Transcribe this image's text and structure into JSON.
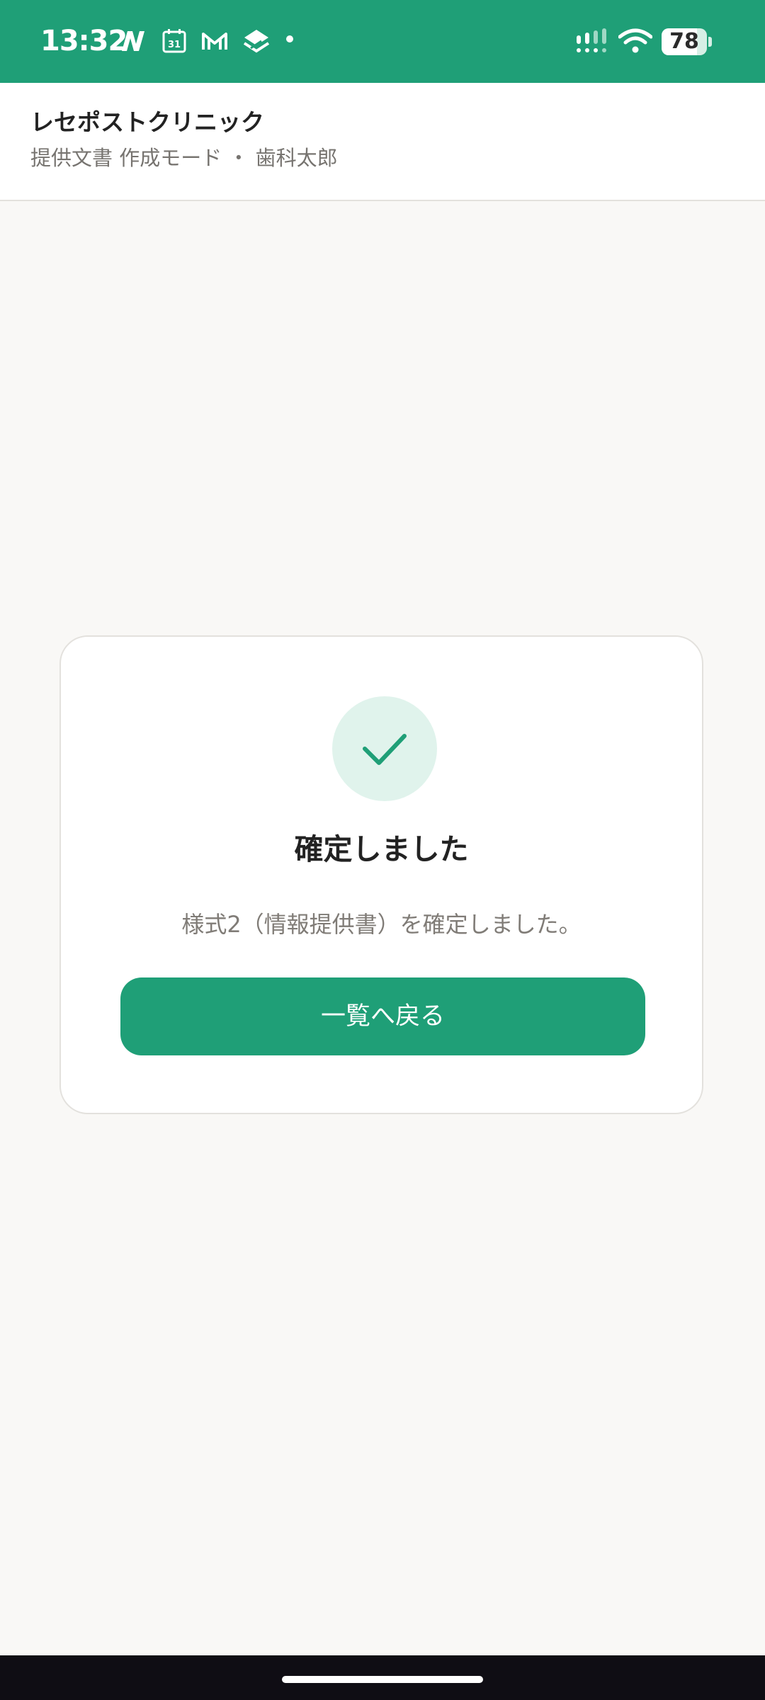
{
  "status_bar": {
    "time": "13:32",
    "calendar_day": "31",
    "battery_level": 78,
    "battery_text": "78",
    "notification_icons": [
      "n-app-icon",
      "calendar-icon",
      "gmail-icon",
      "stack-app-icon",
      "more-notifications-dot-icon"
    ],
    "right_icons": [
      "signal-icon",
      "wifi-icon",
      "battery-icon"
    ],
    "background_color": "#1f9f77"
  },
  "header": {
    "clinic_name": "レセポストクリニック",
    "subtitle": "提供文書 作成モード ・ 歯科太郎"
  },
  "confirmation": {
    "icon": "check-icon",
    "title": "確定しました",
    "message": "様式2（情報提供書）を確定しました。",
    "button_label": "一覧へ戻る"
  },
  "colors": {
    "accent": "#1f9f77",
    "accent_light": "#e0f3ec",
    "background": "#f9f8f6"
  }
}
